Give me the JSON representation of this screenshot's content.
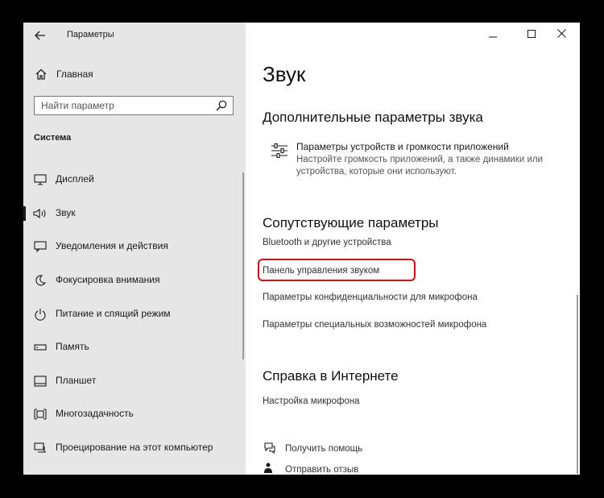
{
  "window": {
    "title": "Параметры",
    "controls": {
      "minimize": "—",
      "maximize": "☐",
      "close": "✕"
    }
  },
  "sidebar": {
    "home_label": "Главная",
    "search_placeholder": "Найти параметр",
    "section_title": "Система",
    "items": [
      {
        "label": "Дисплей",
        "icon": "display-icon"
      },
      {
        "label": "Звук",
        "icon": "speaker-icon",
        "active": true
      },
      {
        "label": "Уведомления и действия",
        "icon": "notification-icon"
      },
      {
        "label": "Фокусировка внимания",
        "icon": "moon-icon"
      },
      {
        "label": "Питание и спящий режим",
        "icon": "power-icon"
      },
      {
        "label": "Память",
        "icon": "storage-icon"
      },
      {
        "label": "Планшет",
        "icon": "tablet-icon"
      },
      {
        "label": "Многозадачность",
        "icon": "multitasking-icon"
      },
      {
        "label": "Проецирование на этот компьютер",
        "icon": "projecting-icon"
      }
    ]
  },
  "main": {
    "page_title": "Звук",
    "advanced": {
      "heading": "Дополнительные параметры звука",
      "item_title": "Параметры устройств и громкости приложений",
      "item_desc": "Настройте громкость приложений, а также динамики или устройства, которые они используют."
    },
    "related": {
      "heading": "Сопутствующие параметры",
      "links": [
        "Bluetooth и другие устройства",
        "Панель управления звуком",
        "Параметры конфиденциальности для микрофона",
        "Параметры специальных возможностей микрофона"
      ]
    },
    "web_help": {
      "heading": "Справка в Интернете",
      "link": "Настройка микрофона"
    },
    "bottom": {
      "get_help": "Получить помощь",
      "feedback": "Отправить отзыв"
    }
  },
  "colors": {
    "sidebar_bg": "#e6e6e6",
    "highlight": "#e10e0e",
    "outer_bg": "#000000"
  }
}
